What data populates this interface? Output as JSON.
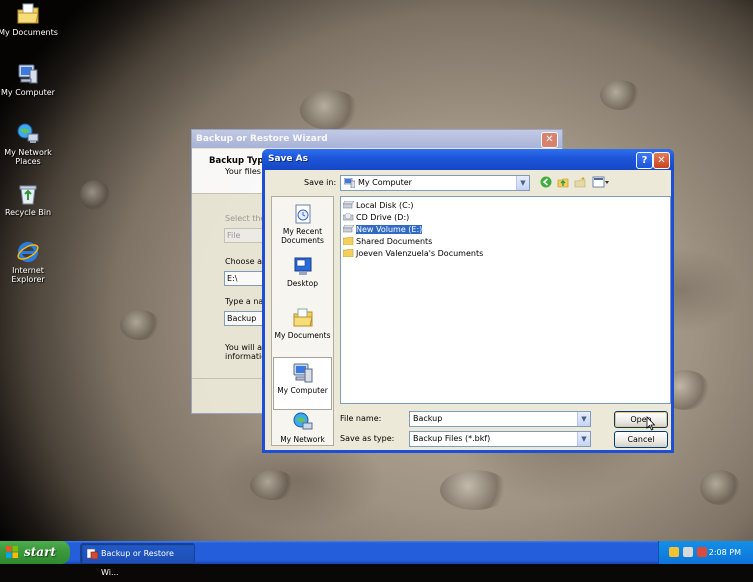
{
  "desktop": {
    "icons": [
      {
        "label": "My Documents",
        "icon": "my-documents-icon"
      },
      {
        "label": "My Computer",
        "icon": "my-computer-icon"
      },
      {
        "label": "My Network Places",
        "icon": "network-places-icon"
      },
      {
        "label": "Recycle Bin",
        "icon": "recycle-bin-icon"
      },
      {
        "label": "Internet Explorer",
        "icon": "internet-explorer-icon"
      }
    ]
  },
  "wizard": {
    "title": "Backup or Restore Wizard",
    "header_title": "Backup Type",
    "header_sub": "Your files a",
    "select_label": "Select the",
    "type_value": "File",
    "choose_label": "Choose a p",
    "location_value": "E:\\",
    "name_label": "Type a nan",
    "name_value": "Backup",
    "info_line1": "You will als",
    "info_line2": "information"
  },
  "saveas": {
    "title": "Save As",
    "help_label": "?",
    "close_label": "✕",
    "save_in_label": "Save in:",
    "save_in_value": "My Computer",
    "places": [
      {
        "label": "My Recent Documents",
        "icon": "recent-documents-icon"
      },
      {
        "label": "Desktop",
        "icon": "desktop-icon"
      },
      {
        "label": "My Documents",
        "icon": "my-documents-icon"
      },
      {
        "label": "My Computer",
        "icon": "my-computer-icon"
      },
      {
        "label": "My Network",
        "icon": "network-places-icon"
      }
    ],
    "files": [
      {
        "label": "Local Disk (C:)",
        "icon": "hard-drive-icon"
      },
      {
        "label": "CD Drive (D:)",
        "icon": "cd-drive-icon"
      },
      {
        "label": "New Volume (E:)",
        "icon": "hard-drive-icon",
        "selected": true
      },
      {
        "label": "Shared Documents",
        "icon": "folder-icon"
      },
      {
        "label": "Joeven Valenzuela's Documents",
        "icon": "folder-icon"
      }
    ],
    "file_name_label": "File name:",
    "file_name_value": "Backup",
    "save_type_label": "Save as type:",
    "save_type_value": "Backup Files (*.bkf)",
    "open_label": "Open",
    "cancel_label": "Cancel"
  },
  "taskbar": {
    "start_label": "start",
    "task_label": "Backup or Restore Wi...",
    "clock": "2:08 PM"
  },
  "colors": {
    "taskbar": "#245edb",
    "start": "#3c9a3c",
    "titlebar": "#1d55d8",
    "selection": "#316ac5"
  }
}
